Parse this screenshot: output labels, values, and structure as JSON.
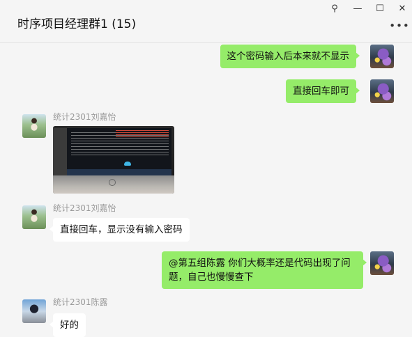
{
  "header": {
    "title": "时序项目经理群1 (15)",
    "controls": {
      "pin": "⚲",
      "minimize": "—",
      "maximize": "☐",
      "close": "✕"
    },
    "more": "•••"
  },
  "messages": [
    {
      "from": "me",
      "text": "这个密码输入后本来就不显示"
    },
    {
      "from": "me",
      "text": "直接回车即可"
    },
    {
      "from": "other",
      "sender": "统计2301刘嘉怡",
      "type": "image"
    },
    {
      "from": "other",
      "sender": "统计2301刘嘉怡",
      "text": "直接回车，显示没有输入密码"
    },
    {
      "from": "me",
      "text": "@第五组陈露 你们大概率还是代码出现了问题，自己也慢慢查下"
    },
    {
      "from": "other",
      "sender": "统计2301陈露",
      "text": "好的"
    }
  ],
  "colors": {
    "my_bubble": "#95ec69",
    "other_bubble": "#ffffff",
    "background": "#f5f5f5",
    "sender_name": "#9a9a9a"
  }
}
